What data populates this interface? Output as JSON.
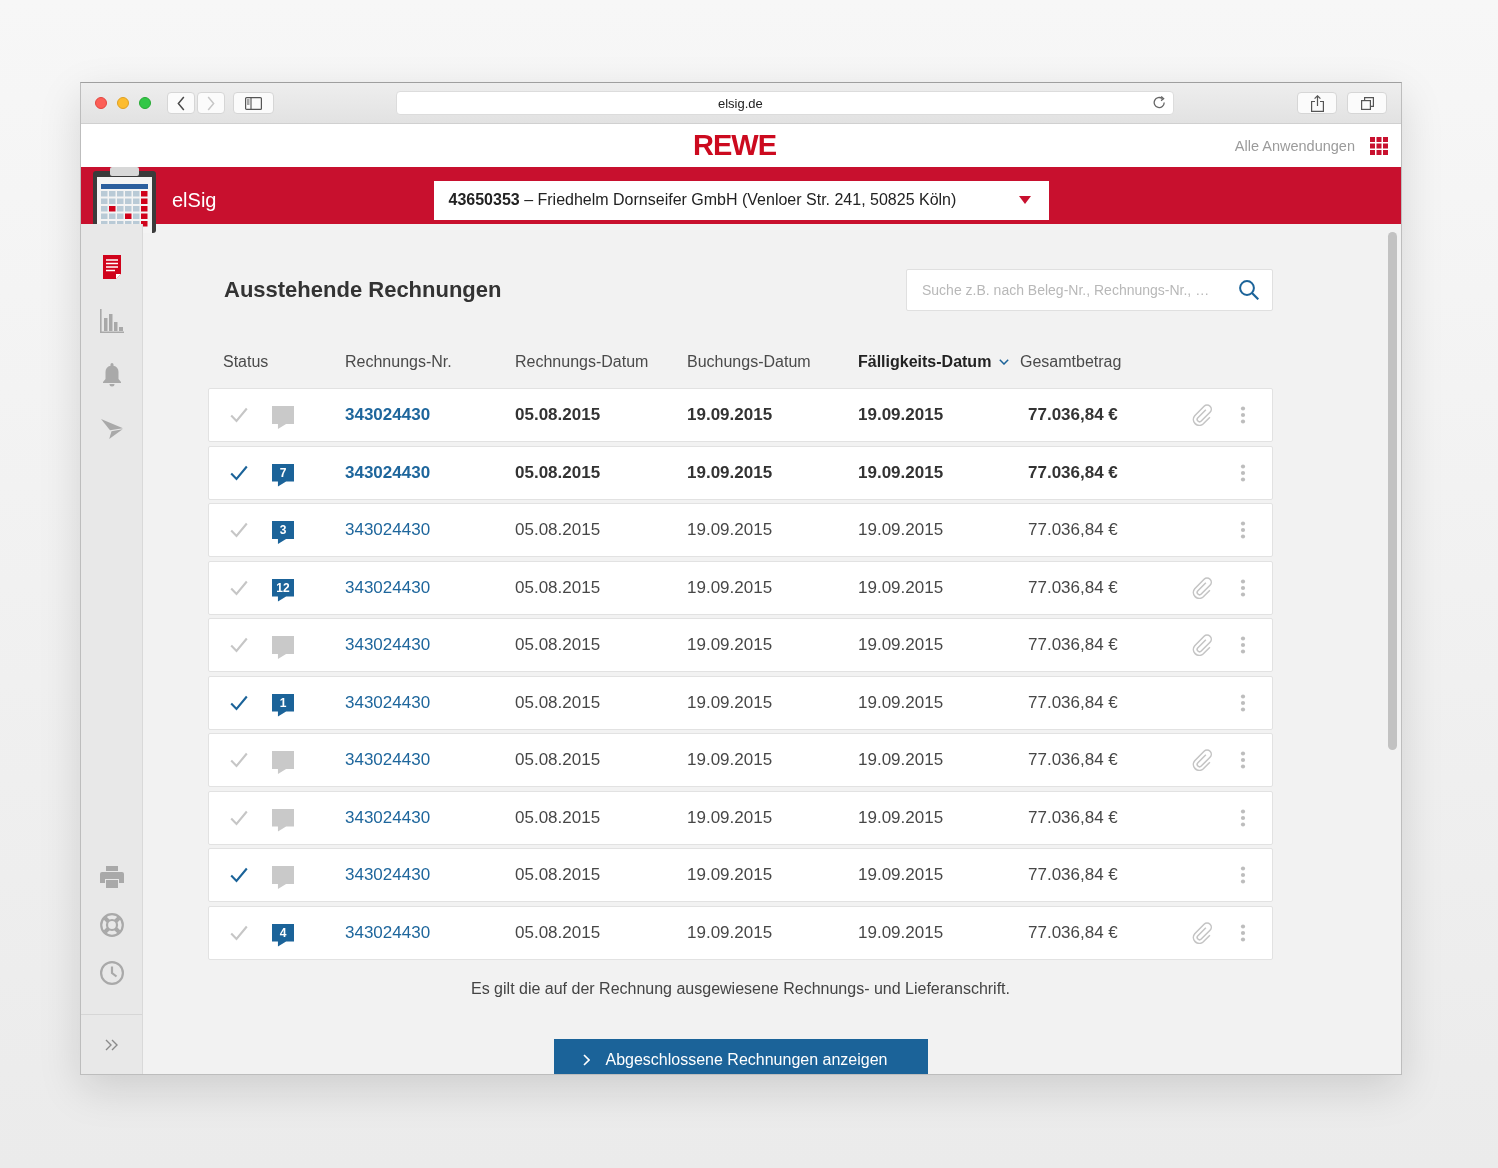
{
  "browser": {
    "url": "elsig.de",
    "forward_disabled": true
  },
  "header": {
    "logo": "REWE",
    "apps_link": "Alle Anwendungen"
  },
  "app_bar": {
    "app_name": "elSig",
    "account": "**43650353** – Friedhelm Dornseifer GmbH (Venloer Str. 241, 50825 Köln)"
  },
  "sidebar": {
    "items": [
      {
        "selected": true
      },
      {
        "selected": false
      },
      {
        "selected": false
      },
      {
        "selected": false
      }
    ]
  },
  "page": {
    "title": "Ausstehende Rechnungen",
    "search": {
      "placeholder": "Suche z.B. nach Beleg-Nr., Rechnungs-Nr., …"
    }
  },
  "table": {
    "columns": [
      {
        "label": "Status",
        "sorted": false
      },
      {
        "label": "Rechnungs-Nr.",
        "sorted": false
      },
      {
        "label": "Rechnungs-Datum",
        "sorted": false
      },
      {
        "label": "Buchungs-Datum",
        "sorted": false
      },
      {
        "label": "Fälligkeits-Datum",
        "sorted": true
      },
      {
        "label": "Gesamtbetrag",
        "sorted": false
      }
    ],
    "rows": [
      {
        "approved": false,
        "invoice_no": "343024430",
        "invoice_date": "05.08.2015",
        "booking_date": "19.09.2015",
        "due_date": "19.09.2015",
        "total": "77.036,84 €",
        "unread": true,
        "attachment": true
      },
      {
        "approved": true,
        "comments": "7",
        "invoice_no": "343024430",
        "invoice_date": "05.08.2015",
        "booking_date": "19.09.2015",
        "due_date": "19.09.2015",
        "total": "77.036,84 €",
        "unread": true,
        "attachment": false
      },
      {
        "approved": false,
        "comments": "3",
        "invoice_no": "343024430",
        "invoice_date": "05.08.2015",
        "booking_date": "19.09.2015",
        "due_date": "19.09.2015",
        "total": "77.036,84 €",
        "unread": false,
        "attachment": false
      },
      {
        "approved": false,
        "comments": "12",
        "invoice_no": "343024430",
        "invoice_date": "05.08.2015",
        "booking_date": "19.09.2015",
        "due_date": "19.09.2015",
        "total": "77.036,84 €",
        "unread": false,
        "attachment": true
      },
      {
        "approved": false,
        "invoice_no": "343024430",
        "invoice_date": "05.08.2015",
        "booking_date": "19.09.2015",
        "due_date": "19.09.2015",
        "total": "77.036,84 €",
        "unread": false,
        "attachment": true
      },
      {
        "approved": true,
        "comments": "1",
        "invoice_no": "343024430",
        "invoice_date": "05.08.2015",
        "booking_date": "19.09.2015",
        "due_date": "19.09.2015",
        "total": "77.036,84 €",
        "unread": false,
        "attachment": false
      },
      {
        "approved": false,
        "invoice_no": "343024430",
        "invoice_date": "05.08.2015",
        "booking_date": "19.09.2015",
        "due_date": "19.09.2015",
        "total": "77.036,84 €",
        "unread": false,
        "attachment": true
      },
      {
        "approved": false,
        "invoice_no": "343024430",
        "invoice_date": "05.08.2015",
        "booking_date": "19.09.2015",
        "due_date": "19.09.2015",
        "total": "77.036,84 €",
        "unread": false,
        "attachment": false
      },
      {
        "approved": true,
        "invoice_no": "343024430",
        "invoice_date": "05.08.2015",
        "booking_date": "19.09.2015",
        "due_date": "19.09.2015",
        "total": "77.036,84 €",
        "unread": false,
        "attachment": false
      },
      {
        "approved": false,
        "comments": "4",
        "invoice_no": "343024430",
        "invoice_date": "05.08.2015",
        "booking_date": "19.09.2015",
        "due_date": "19.09.2015",
        "total": "77.036,84 €",
        "unread": false,
        "attachment": true
      }
    ]
  },
  "note": "Es gilt die auf der Rechnung ausgewiesene Rechnungs- und Lieferanschrift.",
  "show_closed_button": "Abgeschlossene Rechnungen anzeigen"
}
